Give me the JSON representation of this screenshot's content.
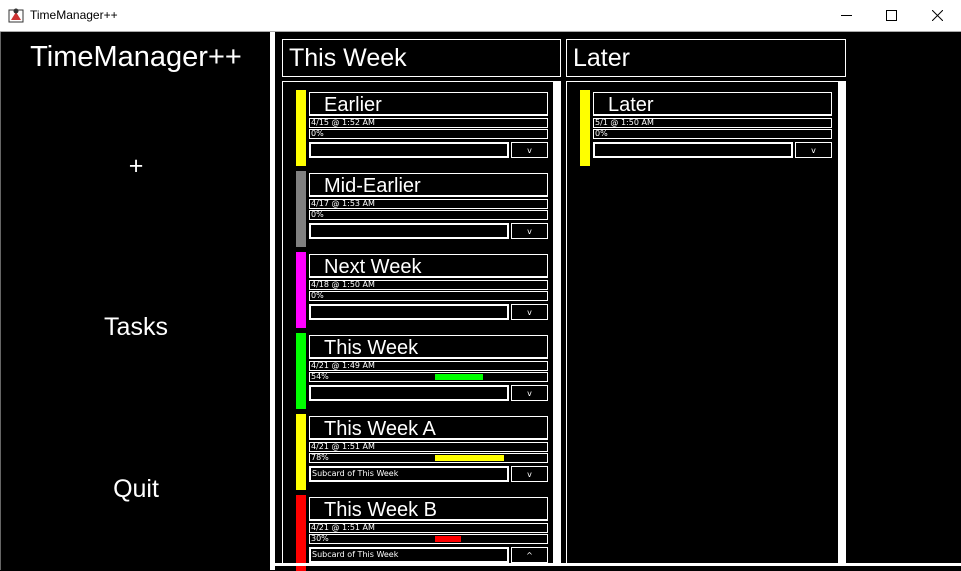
{
  "window": {
    "title": "TimeManager++"
  },
  "sidebar": {
    "title": "TimeManager++",
    "add_label": "+",
    "tasks_label": "Tasks",
    "quit_label": "Quit"
  },
  "columns": [
    {
      "title": "This Week",
      "cards": [
        {
          "title": "Earlier",
          "date": "4/15 @ 1:52 AM",
          "percent": "0%",
          "progress": 0,
          "color": "#ffff00",
          "subtitle": "",
          "toggle": "v"
        },
        {
          "title": "Mid-Earlier",
          "date": "4/17 @ 1:53 AM",
          "percent": "0%",
          "progress": 0,
          "color": "#808080",
          "subtitle": "",
          "toggle": "v"
        },
        {
          "title": "Next Week",
          "date": "4/18 @ 1:50 AM",
          "percent": "0%",
          "progress": 0,
          "color": "#ff00ff",
          "subtitle": "",
          "toggle": "v"
        },
        {
          "title": "This Week",
          "date": "4/21 @ 1:49 AM",
          "percent": "54%",
          "progress": 0.54,
          "color": "#00ff00",
          "subtitle": "",
          "toggle": "v"
        },
        {
          "title": "This Week A",
          "date": "4/21 @ 1:51 AM",
          "percent": "78%",
          "progress": 0.78,
          "color": "#ffff00",
          "subtitle": "Subcard of This Week",
          "toggle": "v"
        },
        {
          "title": "This Week B",
          "date": "4/21 @ 1:51 AM",
          "percent": "30%",
          "progress": 0.3,
          "color": "#ff0000",
          "subtitle": "Subcard of This Week",
          "toggle": "^"
        }
      ]
    },
    {
      "title": "Later",
      "cards": [
        {
          "title": "Later",
          "date": "5/1 @ 1:50 AM",
          "percent": "0%",
          "progress": 0,
          "color": "#ffff00",
          "subtitle": "",
          "toggle": "v"
        }
      ]
    }
  ]
}
